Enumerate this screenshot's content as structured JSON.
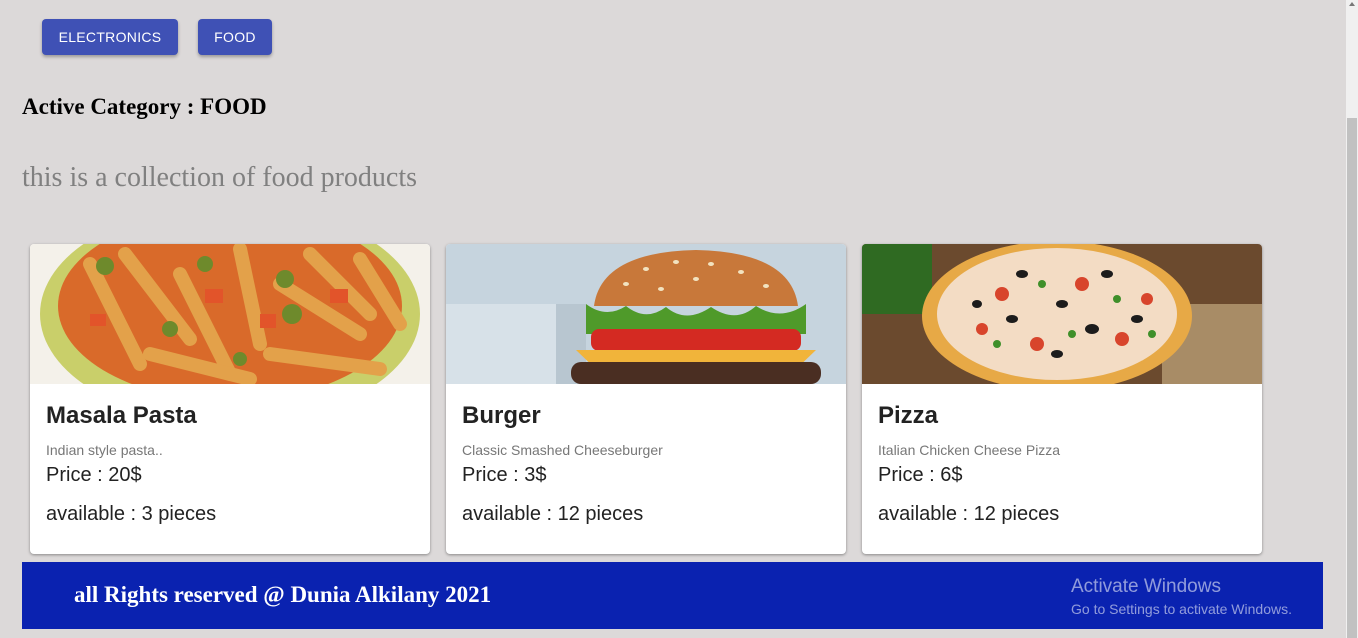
{
  "categories": {
    "electronics_label": "ELECTRONICS",
    "food_label": "FOOD"
  },
  "active_category": "Active Category : FOOD",
  "description": "this is a collection of food products",
  "products": [
    {
      "name": "Masala Pasta",
      "desc": "Indian style pasta..",
      "price": "Price : 20$",
      "available": "available : 3 pieces",
      "image": "pasta-photo"
    },
    {
      "name": "Burger",
      "desc": "Classic Smashed Cheeseburger",
      "price": "Price : 3$",
      "available": "available : 12 pieces",
      "image": "burger-photo"
    },
    {
      "name": "Pizza",
      "desc": "Italian Chicken Cheese Pizza",
      "price": "Price : 6$",
      "available": "available : 12 pieces",
      "image": "pizza-photo"
    }
  ],
  "footer": {
    "text": "all Rights reserved @ Dunia Alkilany 2021"
  },
  "watermark": {
    "title": "Activate Windows",
    "subtitle": "Go to Settings to activate Windows."
  },
  "colors": {
    "primary_button": "#3f51b5",
    "footer_bg": "#0a22b0",
    "page_bg": "#dcd9d9"
  }
}
